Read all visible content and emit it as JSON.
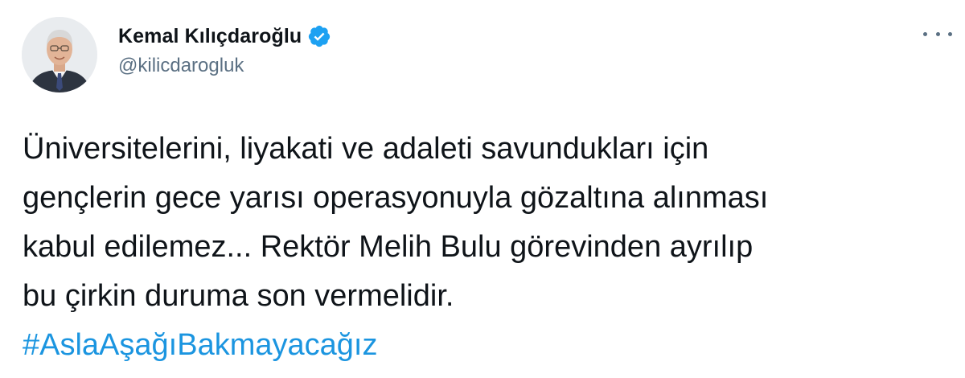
{
  "author": {
    "display_name": "Kemal Kılıçdaroğlu",
    "handle": "@kilicdarogluk",
    "verified": true
  },
  "icons": {
    "avatar": "profile-photo",
    "verified": "verified-badge-icon",
    "more": "more-options-icon"
  },
  "colors": {
    "name": "#0f1419",
    "handle": "#5b7083",
    "text": "#0f1419",
    "link": "#1b95e0",
    "verified": "#1da1f2"
  },
  "tweet": {
    "lines": [
      "Üniversitelerini, liyakati ve adaleti savundukları için",
      "gençlerin gece yarısı operasyonuyla gözaltına alınması",
      "kabul edilemez... Rektör Melih Bulu görevinden ayrılıp",
      "bu çirkin duruma son vermelidir."
    ],
    "hashtag": "#AslaAşağıBakmayacağız"
  }
}
